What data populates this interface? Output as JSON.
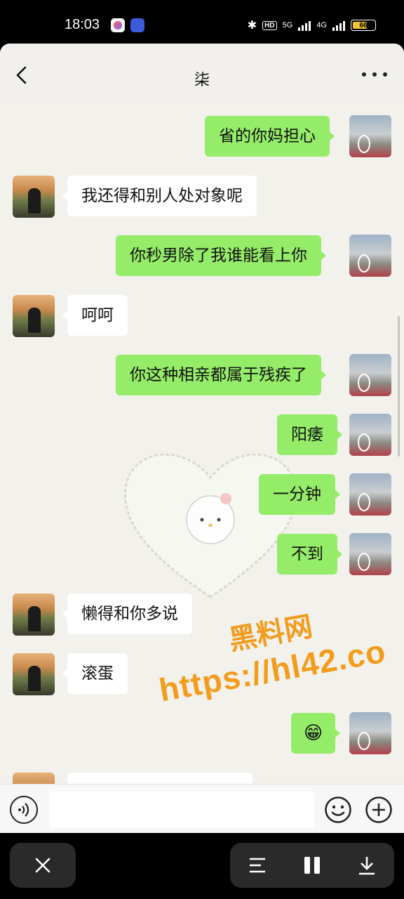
{
  "status_bar": {
    "time": "18:03",
    "network_tag": "HD",
    "net_5g": "5G",
    "net_4g": "4G",
    "battery": "66",
    "battery_level_percent": 66
  },
  "chat": {
    "title": "柒"
  },
  "messages": [
    {
      "side": "out",
      "text": "省的你妈担心"
    },
    {
      "side": "in",
      "text": "我还得和别人处对象呢"
    },
    {
      "side": "out",
      "text": "你秒男除了我谁能看上你"
    },
    {
      "side": "in",
      "text": "呵呵"
    },
    {
      "side": "out",
      "text": "你这种相亲都属于残疾了"
    },
    {
      "side": "out",
      "text": "阳痿"
    },
    {
      "side": "out",
      "text": "一分钟"
    },
    {
      "side": "out",
      "text": "不到"
    },
    {
      "side": "in",
      "text": "懒得和你多说"
    },
    {
      "side": "in",
      "text": "滚蛋"
    },
    {
      "side": "out",
      "text": "😁"
    }
  ],
  "watermark": {
    "line1": "黑料网",
    "line2": "https://hl42.co"
  },
  "icons": {
    "back": "chevron-left-icon",
    "more": "more-dots-icon",
    "voice": "voice-icon",
    "emoji": "smiley-icon",
    "plus": "plus-icon",
    "close": "close-icon",
    "menu": "menu-icon",
    "pause": "pause-icon",
    "download": "download-icon"
  },
  "colors": {
    "outgoing_bubble": "#95ec69",
    "incoming_bubble": "#ffffff",
    "chat_background": "#f3f1ec",
    "watermark": "#f39c1c"
  }
}
